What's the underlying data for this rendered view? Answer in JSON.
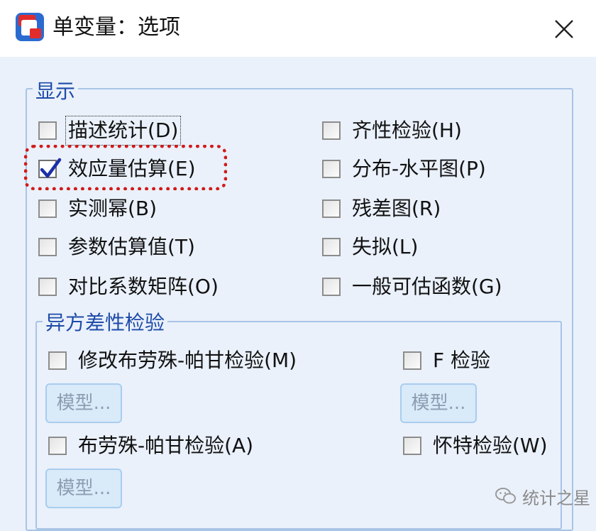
{
  "window": {
    "title": "单变量：选项",
    "close_glyph": "✕"
  },
  "display_group": {
    "legend": "显示",
    "left_items": [
      {
        "label": "描述统计(D)",
        "checked": false
      },
      {
        "label": "效应量估算(E)",
        "checked": true
      },
      {
        "label": "实测幂(B)",
        "checked": false
      },
      {
        "label": "参数估算值(T)",
        "checked": false
      },
      {
        "label": "对比系数矩阵(O)",
        "checked": false
      }
    ],
    "right_items": [
      {
        "label": "齐性检验(H)",
        "checked": false
      },
      {
        "label": "分布-水平图(P)",
        "checked": false
      },
      {
        "label": "残差图(R)",
        "checked": false
      },
      {
        "label": "失拟(L)",
        "checked": false
      },
      {
        "label": "一般可估函数(G)",
        "checked": false
      }
    ]
  },
  "hetero_group": {
    "legend": "异方差性检验",
    "items": [
      {
        "label": "修改布劳殊-帕甘检验(M)",
        "checked": false
      },
      {
        "label": "F 检验",
        "checked": false
      },
      {
        "label": "布劳殊-帕甘检验(A)",
        "checked": false
      },
      {
        "label": "怀特检验(W)",
        "checked": false
      }
    ],
    "model_button_label": "模型..."
  },
  "watermark": {
    "text": "统计之星"
  },
  "colors": {
    "background": "#eaf1fb",
    "legend_text": "#1e4ba8",
    "highlight": "#d21a1a",
    "checkmark": "#1a2fa8"
  }
}
